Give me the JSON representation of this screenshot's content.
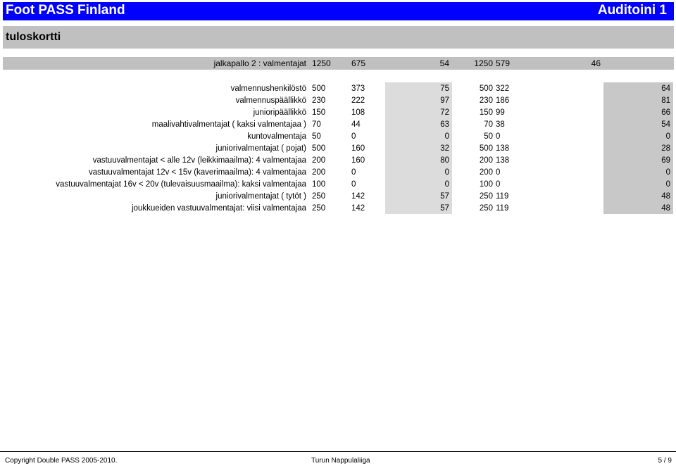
{
  "header": {
    "left": "Foot PASS Finland",
    "right": "Auditoini 1"
  },
  "subhead": {
    "title": "tuloskortti"
  },
  "summary": {
    "label": "jalkapallo 2 : valmentajat",
    "v1": "1250",
    "v2": "675",
    "v3": "54",
    "v4": "1250",
    "v5": "579",
    "v6": "46"
  },
  "rows": [
    {
      "label": "valmennushenkilöstö",
      "v1": "500",
      "v2": "373",
      "v3": "75",
      "v4": "500",
      "v5": "322",
      "v6": "64",
      "type": "section"
    },
    {
      "label": "valmennuspäällikkö",
      "v1": "230",
      "v2": "222",
      "v3": "97",
      "v4": "230",
      "v5": "186",
      "v6": "81",
      "type": "item"
    },
    {
      "label": "junioripäällikkö",
      "v1": "150",
      "v2": "108",
      "v3": "72",
      "v4": "150",
      "v5": "99",
      "v6": "66",
      "type": "item"
    },
    {
      "label": "maalivahtivalmentajat ( kaksi valmentajaa )",
      "v1": "70",
      "v2": "44",
      "v3": "63",
      "v4": "70",
      "v5": "38",
      "v6": "54",
      "type": "item"
    },
    {
      "label": "kuntovalmentaja",
      "v1": "50",
      "v2": "0",
      "v3": "0",
      "v4": "50",
      "v5": "0",
      "v6": "0",
      "type": "item"
    },
    {
      "label": "juniorivalmentajat ( pojat)",
      "v1": "500",
      "v2": "160",
      "v3": "32",
      "v4": "500",
      "v5": "138",
      "v6": "28",
      "type": "section"
    },
    {
      "label": "vastuuvalmentajat < alle 12v (leikkimaailma): 4 valmentajaa",
      "v1": "200",
      "v2": "160",
      "v3": "80",
      "v4": "200",
      "v5": "138",
      "v6": "69",
      "type": "item"
    },
    {
      "label": "vastuuvalmentajat  12v < 15v (kaverimaailma): 4 valmentajaa",
      "v1": "200",
      "v2": "0",
      "v3": "0",
      "v4": "200",
      "v5": "0",
      "v6": "0",
      "type": "item"
    },
    {
      "label": "vastuuvalmentajat 16v < 20v (tulevaisuusmaailma): kaksi valmentajaa",
      "v1": "100",
      "v2": "0",
      "v3": "0",
      "v4": "100",
      "v5": "0",
      "v6": "0",
      "type": "item"
    },
    {
      "label": "juniorivalmentajat ( tytöt )",
      "v1": "250",
      "v2": "142",
      "v3": "57",
      "v4": "250",
      "v5": "119",
      "v6": "48",
      "type": "section"
    },
    {
      "label": "joukkueiden vastuuvalmentajat: viisi valmentajaa",
      "v1": "250",
      "v2": "142",
      "v3": "57",
      "v4": "250",
      "v5": "119",
      "v6": "48",
      "type": "item"
    }
  ],
  "footer": {
    "copyright": "Copyright Double PASS 2005-2010.",
    "org": "Turun Nappulaliiga",
    "page": "5 / 9"
  }
}
